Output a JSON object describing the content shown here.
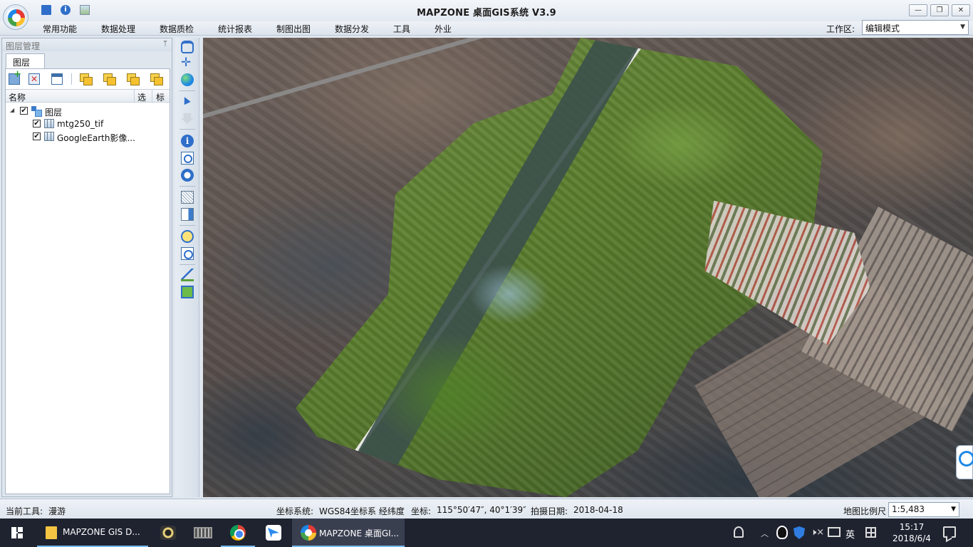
{
  "window": {
    "title": "MAPZONE 桌面GIS系统 V3.9",
    "min_glyph": "—",
    "max_glyph": "❐",
    "close_glyph": "✕"
  },
  "quick_access": {
    "info_glyph": "i"
  },
  "menu": {
    "items": [
      "常用功能",
      "数据处理",
      "数据质检",
      "统计报表",
      "制图出图",
      "数据分发",
      "工具",
      "外业"
    ],
    "workspace_label": "工作区:",
    "workspace_value": "编辑模式"
  },
  "layer_panel": {
    "title": "图层管理",
    "pin_glyph": "ᛘ",
    "tab": "图层",
    "delete_glyph": "✕",
    "columns": {
      "name": "名称",
      "select": "选",
      "label": "标"
    },
    "tree": {
      "root": {
        "label": "图层",
        "checked": "✔",
        "expander": "◢"
      },
      "children": [
        {
          "label": "mtg250_tif",
          "checked": "✔"
        },
        {
          "label": "GoogleEarth影像...",
          "checked": "✔"
        }
      ]
    }
  },
  "vertical_tools": {
    "info_glyph": "i"
  },
  "status": {
    "current_tool_label": "当前工具:",
    "current_tool": "漫游",
    "crs_label": "坐标系统:",
    "crs_value": "WGS84坐标系 经纬度",
    "coord_label": "坐标:",
    "coord_value": "115°50′47″, 40°1′39″",
    "date_label": "拍摄日期:",
    "date_value": "2018-04-18",
    "scale_label": "地图比例尺",
    "scale_value": "1:5,483"
  },
  "dropdown_glyph": "▼",
  "taskbar": {
    "items": [
      {
        "label": "MAPZONE GIS D..."
      },
      {
        "label": "MAPZONE 桌面GI..."
      }
    ],
    "up_glyph": "︿",
    "volume_glyph": "🕨×",
    "ime": "英",
    "time": "15:17",
    "date": "2018/6/4"
  }
}
